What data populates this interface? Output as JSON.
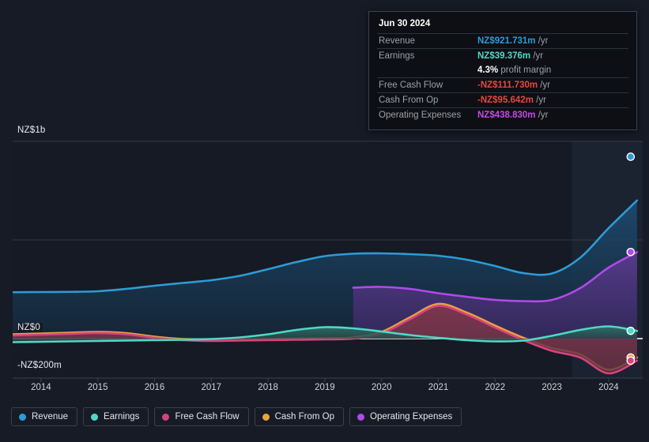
{
  "tooltip": {
    "date": "Jun 30 2024",
    "rows": [
      {
        "label": "Revenue",
        "value": "NZ$921.731m",
        "unit": "/yr",
        "color": "#2e9bd6"
      },
      {
        "label": "Earnings",
        "value": "NZ$39.376m",
        "unit": "/yr",
        "color": "#4fd9c5"
      },
      {
        "label": "",
        "value": "4.3%",
        "unit": "profit margin",
        "color": "#ffffff"
      },
      {
        "label": "Free Cash Flow",
        "value": "-NZ$111.730m",
        "unit": "/yr",
        "color": "#e8463c"
      },
      {
        "label": "Cash From Op",
        "value": "-NZ$95.642m",
        "unit": "/yr",
        "color": "#e8463c"
      },
      {
        "label": "Operating Expenses",
        "value": "NZ$438.830m",
        "unit": "/yr",
        "color": "#c44ae8"
      }
    ]
  },
  "axes": {
    "y_labels": [
      "NZ$1b",
      "NZ$0",
      "-NZ$200m"
    ],
    "x_labels": [
      "2014",
      "2015",
      "2016",
      "2017",
      "2018",
      "2019",
      "2020",
      "2021",
      "2022",
      "2023",
      "2024"
    ],
    "ymin": -200,
    "ymax": 1000,
    "gridlines": [
      1000,
      500,
      0
    ]
  },
  "legend": [
    {
      "label": "Revenue",
      "color": "#2e9bd6"
    },
    {
      "label": "Earnings",
      "color": "#4fd9c5"
    },
    {
      "label": "Free Cash Flow",
      "color": "#d6437f"
    },
    {
      "label": "Cash From Op",
      "color": "#e8a33d"
    },
    {
      "label": "Operating Expenses",
      "color": "#b14ae8"
    }
  ],
  "chart_data": {
    "type": "area",
    "title": "",
    "xlabel": "",
    "ylabel": "NZ$",
    "units": "NZ$ millions per year",
    "xlim": [
      2013.5,
      2024.6
    ],
    "ylim": [
      -200,
      1000
    ],
    "x": [
      2013.5,
      2014,
      2014.5,
      2015,
      2015.5,
      2016,
      2016.5,
      2017,
      2017.5,
      2018,
      2018.5,
      2019,
      2019.5,
      2020,
      2020.5,
      2021,
      2021.5,
      2022,
      2022.5,
      2023,
      2023.5,
      2024,
      2024.5
    ],
    "series": [
      {
        "name": "Revenue",
        "color": "#2e9bd6",
        "fill": "#173css",
        "values": [
          235,
          236,
          237,
          240,
          252,
          268,
          282,
          296,
          318,
          352,
          388,
          418,
          430,
          432,
          428,
          420,
          400,
          368,
          332,
          330,
          410,
          560,
          700
        ]
      },
      {
        "name": "Operating Expenses",
        "color": "#b14ae8",
        "values": [
          null,
          null,
          null,
          null,
          null,
          null,
          null,
          null,
          null,
          null,
          null,
          null,
          258,
          262,
          252,
          230,
          212,
          196,
          190,
          196,
          256,
          360,
          438
        ]
      },
      {
        "name": "Earnings",
        "color": "#4fd9c5",
        "values": [
          -18,
          -16,
          -14,
          -12,
          -10,
          -8,
          -6,
          -2,
          6,
          22,
          44,
          58,
          52,
          36,
          18,
          4,
          -8,
          -14,
          -10,
          14,
          44,
          62,
          39
        ]
      },
      {
        "name": "Cash From Op",
        "color": "#e8a33d",
        "values": [
          22,
          26,
          30,
          34,
          28,
          10,
          -2,
          -6,
          -4,
          -2,
          0,
          2,
          6,
          34,
          108,
          176,
          132,
          66,
          4,
          -48,
          -80,
          -158,
          -96
        ]
      },
      {
        "name": "Free Cash Flow",
        "color": "#d6437f",
        "values": [
          16,
          20,
          24,
          28,
          22,
          4,
          -8,
          -12,
          -10,
          -8,
          -6,
          -4,
          0,
          26,
          98,
          166,
          122,
          56,
          -8,
          -62,
          -96,
          -176,
          -112
        ]
      }
    ],
    "endpoints": [
      {
        "name": "Revenue",
        "value": 921.731,
        "color": "#2e9bd6"
      },
      {
        "name": "Operating Expenses",
        "value": 438.83,
        "color": "#b14ae8"
      },
      {
        "name": "Earnings",
        "value": 39.376,
        "color": "#4fd9c5"
      },
      {
        "name": "Cash From Op",
        "value": -95.642,
        "color": "#e8a33d"
      },
      {
        "name": "Free Cash Flow",
        "value": -111.73,
        "color": "#d6437f"
      }
    ],
    "forecast_divider_x": 2023.35,
    "legend_position": "bottom"
  }
}
